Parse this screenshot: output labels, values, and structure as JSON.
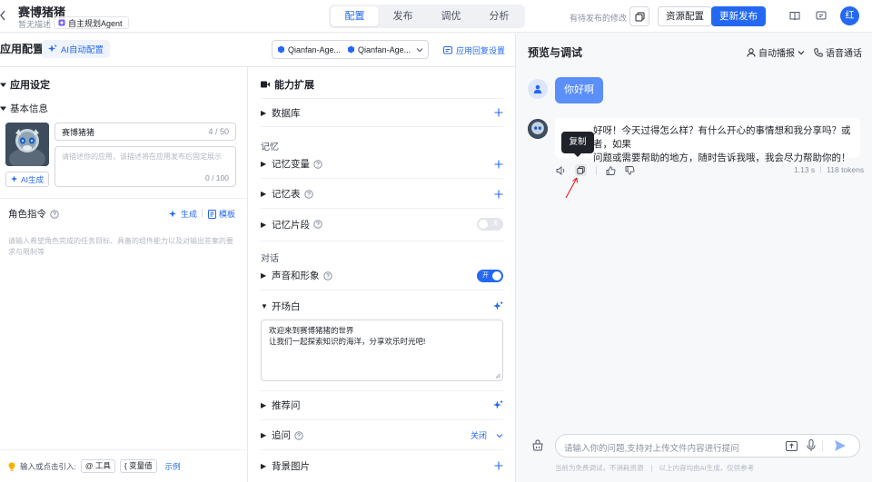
{
  "topbar": {
    "title": "赛博猪猪",
    "subtitle": "暂无描述",
    "agent_tag": "自主规划Agent",
    "tabs": [
      {
        "label": "配置",
        "active": true
      },
      {
        "label": "发布",
        "active": false
      },
      {
        "label": "调优",
        "active": false
      },
      {
        "label": "分析",
        "active": false
      }
    ],
    "pending_changes": "有待发布的修改",
    "resource_config": "资源配置",
    "publish_update": "更新发布",
    "user_avatar": "红"
  },
  "left_panel": {
    "title": "应用配置",
    "ai_auto_config": "AI自动配置",
    "model_select_1": "Qianfan-Age...",
    "model_select_2": "Qianfan-Age...",
    "reply_settings": "应用回复设置",
    "app_settings": "应用设定",
    "basic_info": "基本信息",
    "name_value": "赛博猪猪",
    "name_count": "4 / 50",
    "desc_placeholder": "请描述你的应用，该描述将在应用发布后固定展示",
    "desc_count": "0 / 100",
    "ai_generate": "AI生成",
    "role_instruction": "角色指令",
    "generate": "生成",
    "template": "模板",
    "instruction_placeholder": "请输入希望角色完成的任务目标、具备的组件能力以及对输出答案的要求与限制等",
    "footer_hint": "输入或点击引入:",
    "chip_tool": "@ 工具",
    "chip_var": "{ 变量值",
    "example": "示例"
  },
  "middle_panel": {
    "capability": "能力扩展",
    "database": "数据库",
    "memory_group": "记忆",
    "memory_vars": "记忆变量",
    "memory_table": "记忆表",
    "memory_snippets": "记忆片段",
    "memory_snippets_toggle": "关",
    "dialog_group": "对话",
    "voice_image": "声音和形象",
    "voice_toggle": "开",
    "opening": "开场白",
    "opening_line1": "欢迎来到赛博猪猪的世界",
    "opening_line2": "让我们一起探索知识的海洋，分享欢乐时光吧!",
    "suggested_questions": "推荐问",
    "follow_up": "追问",
    "follow_up_value": "关闭",
    "background_image": "背景图片"
  },
  "right_panel": {
    "title": "预览与调试",
    "auto_play": "自动播报",
    "voice_call": "语音通话",
    "user_message": "你好啊",
    "bot_message_line1": "你好呀！今天过得怎么样？有什么开心的事情想和我分享吗？或者，如果",
    "bot_message_line2": "你有什么问题或需要帮助的地方，随时告诉我哦，我会尽力帮助你的！",
    "bot_message_visible_1": "好呀！今天过得怎么样？有什么开心的事情想和我分享吗？或者，如果",
    "bot_message_visible_2": "问题或需要帮助的地方，随时告诉我哦，我会尽力帮助你的！",
    "tooltip": "复制",
    "latency": "1.13 s",
    "tokens": "118 tokens",
    "input_placeholder": "请输入你的问题,支持对上传文件内容进行提问",
    "footer_left": "当前为免费调试，不消耗资源",
    "footer_right": "以上内容均由AI生成，仅供参考"
  },
  "colors": {
    "accent": "#2468f2",
    "user_bubble": "#5b8ff9",
    "annotation_arrow": "#e02020"
  }
}
